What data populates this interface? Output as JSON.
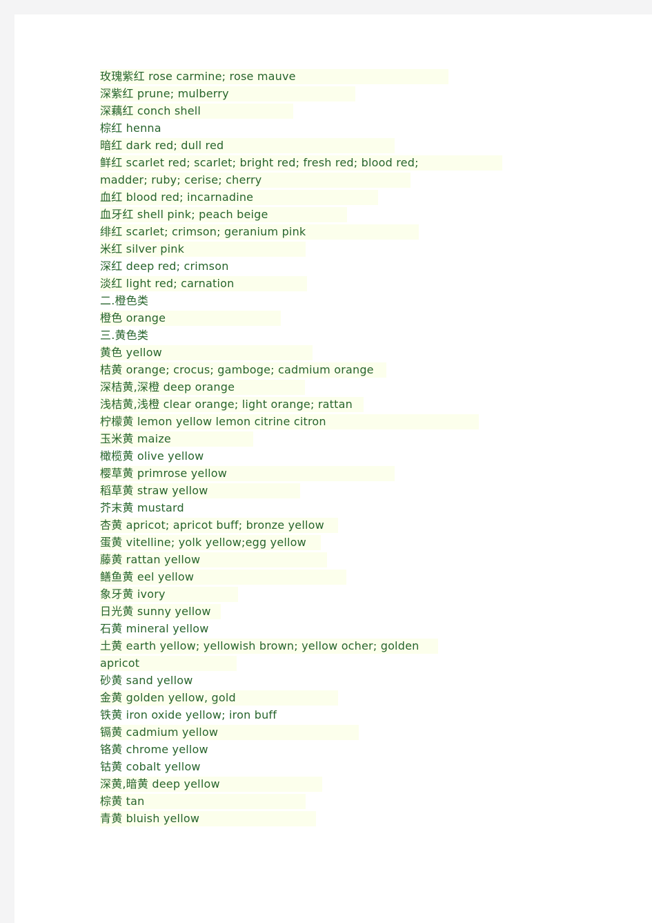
{
  "document": {
    "text_color": "#27642c",
    "highlight_color": "#fcffec",
    "page_background": "#ffffff",
    "gutter_color": "#f4f4f5",
    "lines": [
      {
        "text": "玫瑰紫红 rose carmine; rose mauve",
        "highlight": true,
        "highlight_width": 505
      },
      {
        "text": "深紫红 prune; mulberry",
        "highlight": true,
        "highlight_width": 370
      },
      {
        "text": "深藕红 conch shell",
        "highlight": true,
        "highlight_width": 280
      },
      {
        "text": "棕红 henna",
        "highlight": false,
        "highlight_width": 0
      },
      {
        "text": "暗红 dark red; dull red",
        "highlight": true,
        "highlight_width": 427
      },
      {
        "text": "鲜红 scarlet red; scarlet; bright red; fresh red; blood red;",
        "highlight": true,
        "highlight_width": 583
      },
      {
        "text": "madder; ruby; cerise; cherry",
        "highlight": true,
        "highlight_width": 450
      },
      {
        "text": "血红 blood red; incarnadine",
        "highlight": true,
        "highlight_width": 403
      },
      {
        "text": "血牙红 shell pink; peach beige",
        "highlight": true,
        "highlight_width": 358
      },
      {
        "text": "绯红 scarlet; crimson; geranium pink",
        "highlight": true,
        "highlight_width": 462
      },
      {
        "text": "米红 silver pink",
        "highlight": true,
        "highlight_width": 298
      },
      {
        "text": "深红 deep red; crimson",
        "highlight": false,
        "highlight_width": 0
      },
      {
        "text": "淡红 light red; carnation",
        "highlight": true,
        "highlight_width": 300
      },
      {
        "text": "二.橙色类",
        "highlight": false,
        "highlight_width": 0
      },
      {
        "text": "橙色 orange",
        "highlight": true,
        "highlight_width": 262
      },
      {
        "text": "三.黄色类",
        "highlight": false,
        "highlight_width": 0
      },
      {
        "text": "黄色 yellow",
        "highlight": true,
        "highlight_width": 308
      },
      {
        "text": "桔黄 orange; crocus; gamboge; cadmium orange",
        "highlight": true,
        "highlight_width": 415
      },
      {
        "text": "深桔黄,深橙 deep orange",
        "highlight": true,
        "highlight_width": 297
      },
      {
        "text": "浅桔黄,浅橙 clear orange; light orange; rattan",
        "highlight": true,
        "highlight_width": 382
      },
      {
        "text": "柠檬黄 lemon yellow lemon citrine citron",
        "highlight": true,
        "highlight_width": 549
      },
      {
        "text": "玉米黄 maize",
        "highlight": true,
        "highlight_width": 222
      },
      {
        "text": "橄榄黄 olive yellow",
        "highlight": false,
        "highlight_width": 0
      },
      {
        "text": "樱草黄 primrose yellow",
        "highlight": true,
        "highlight_width": 427
      },
      {
        "text": "稻草黄 straw yellow",
        "highlight": true,
        "highlight_width": 290
      },
      {
        "text": "芥末黄 mustard",
        "highlight": false,
        "highlight_width": 0
      },
      {
        "text": "杏黄 apricot; apricot buff; bronze yellow",
        "highlight": true,
        "highlight_width": 345
      },
      {
        "text": "蛋黄 vitelline; yolk yellow;egg yellow",
        "highlight": true,
        "highlight_width": 320
      },
      {
        "text": "藤黄 rattan yellow",
        "highlight": true,
        "highlight_width": 329
      },
      {
        "text": "鳝鱼黄 eel yellow",
        "highlight": true,
        "highlight_width": 357
      },
      {
        "text": "象牙黄 ivory",
        "highlight": true,
        "highlight_width": 200
      },
      {
        "text": "日光黄 sunny yellow",
        "highlight": true,
        "highlight_width": 175
      },
      {
        "text": "石黄 mineral yellow",
        "highlight": false,
        "highlight_width": 0
      },
      {
        "text": "土黄 earth yellow; yellowish brown; yellow ocher; golden",
        "highlight": true,
        "highlight_width": 490
      },
      {
        "text": "apricot",
        "highlight": true,
        "highlight_width": 198
      },
      {
        "text": "砂黄 sand yellow",
        "highlight": false,
        "highlight_width": 0
      },
      {
        "text": "金黄 golden yellow, gold",
        "highlight": true,
        "highlight_width": 345
      },
      {
        "text": "铁黄 iron oxide yellow; iron buff",
        "highlight": false,
        "highlight_width": 0
      },
      {
        "text": "镉黄 cadmium yellow",
        "highlight": true,
        "highlight_width": 375
      },
      {
        "text": "铬黄 chrome yellow",
        "highlight": false,
        "highlight_width": 0
      },
      {
        "text": "钴黄 cobalt yellow",
        "highlight": false,
        "highlight_width": 0
      },
      {
        "text": "深黄,暗黄 deep yellow",
        "highlight": true,
        "highlight_width": 322
      },
      {
        "text": "棕黄 tan",
        "highlight": true,
        "highlight_width": 298
      },
      {
        "text": "青黄 bluish yellow",
        "highlight": true,
        "highlight_width": 313
      }
    ]
  }
}
